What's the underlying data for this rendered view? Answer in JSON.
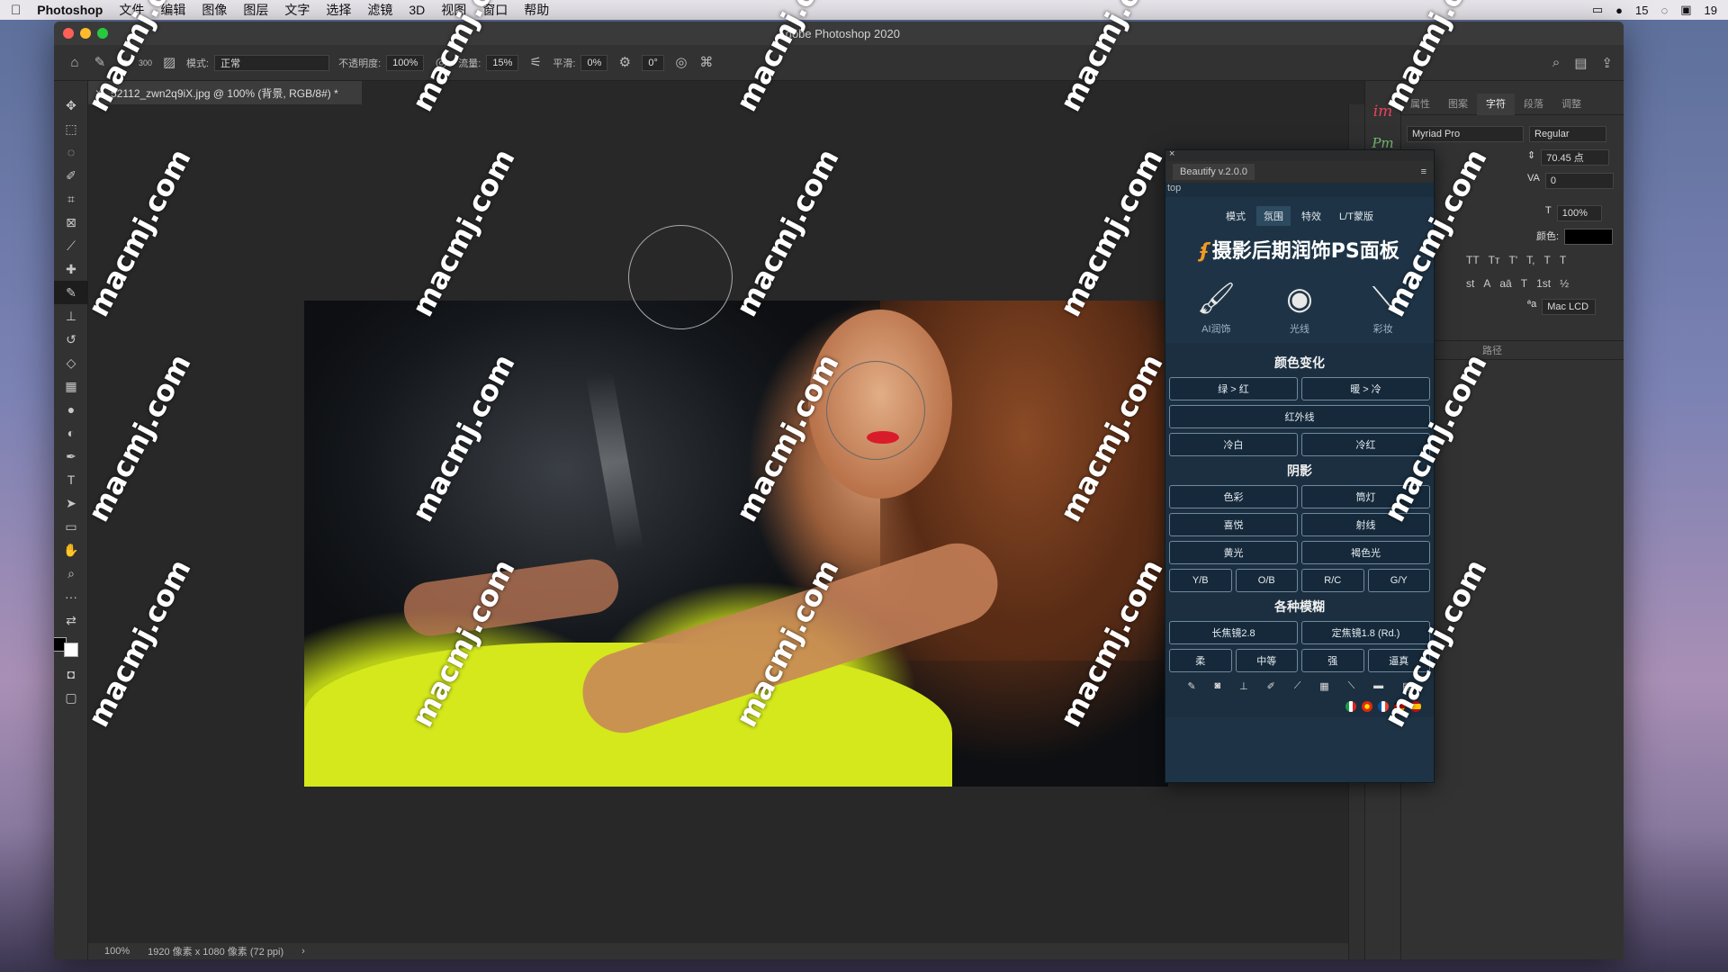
{
  "menubar": {
    "app": "Photoshop",
    "items": [
      "文件",
      "编辑",
      "图像",
      "图层",
      "文字",
      "选择",
      "滤镜",
      "3D",
      "视图",
      "窗口",
      "帮助"
    ],
    "status_right": [
      "15",
      "19"
    ]
  },
  "window": {
    "title": "Adobe Photoshop 2020"
  },
  "options": {
    "brush_size": "300",
    "mode_label": "模式:",
    "mode_value": "正常",
    "opacity_label": "不透明度:",
    "opacity_value": "100%",
    "flow_label": "流量:",
    "flow_value": "15%",
    "smooth_label": "平滑:",
    "smooth_value": "0%",
    "angle_value": "0°"
  },
  "document": {
    "tab_title": "52112_zwn2q9iX.jpg @ 100% (背景, RGB/8#) *",
    "zoom": "100%",
    "info": "1920 像素 x 1080 像素 (72 ppi)"
  },
  "right_panel": {
    "tabs": [
      "属性",
      "图案",
      "字符",
      "段落",
      "调整"
    ],
    "active_tab": "字符",
    "font_family": "Myriad Pro",
    "font_style": "Regular",
    "leading": "70.45 点",
    "tracking": "0",
    "scale": "100%",
    "color_label": "颜色:",
    "antialias": "Mac LCD",
    "aa_label": "ªa",
    "path_tab": "路径",
    "char_buttons": [
      "TT",
      "Tт",
      "T'",
      "T,",
      "T",
      "T"
    ],
    "char_buttons2": [
      "st",
      "A",
      "aā",
      "T",
      "1st",
      "½"
    ]
  },
  "dock": {
    "im_label": "im",
    "pm_label": "Pm"
  },
  "beautify": {
    "title": "Beautify v.2.0.0",
    "subtitle": "top",
    "tabs": [
      "模式",
      "氛围",
      "特效",
      "L/T蒙版"
    ],
    "active_tab": "氛围",
    "banner": "摄影后期润饰PS面板",
    "icons": [
      {
        "label": "AI润饰",
        "icon": "brush-icon"
      },
      {
        "label": "光线",
        "icon": "compact-mirror-icon"
      },
      {
        "label": "彩妆",
        "icon": "makeup-brush-icon"
      }
    ],
    "sections": [
      {
        "title": "颜色变化",
        "rows": [
          [
            "绿 > 红",
            "暖 > 冷"
          ],
          [
            "红外线"
          ],
          [
            "冷白",
            "冷红"
          ]
        ]
      },
      {
        "title": "阴影",
        "rows": [
          [
            "色彩",
            "筒灯"
          ],
          [
            "喜悦",
            "射线"
          ],
          [
            "黄光",
            "褐色光"
          ],
          [
            "Y/B",
            "O/B",
            "R/C",
            "G/Y"
          ]
        ]
      },
      {
        "title": "各种模糊",
        "rows": [
          [
            "长焦镜2.8",
            "定焦镜1.8 (Rd.)"
          ],
          [
            "柔",
            "中等",
            "强",
            "逼真"
          ]
        ]
      }
    ]
  },
  "watermark": "macmj.com"
}
